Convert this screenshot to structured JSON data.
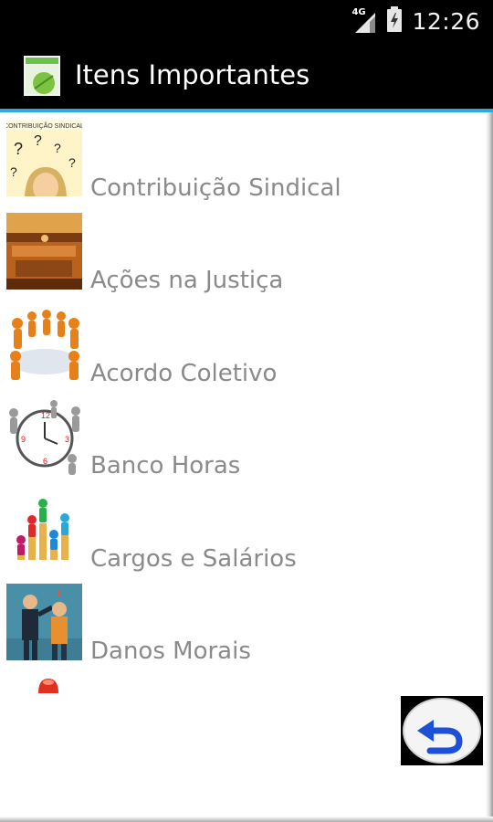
{
  "status_bar": {
    "network": "4G",
    "time": "12:26"
  },
  "action_bar": {
    "title": "Itens Importantes"
  },
  "list": {
    "items": [
      {
        "label": "Contribuição Sindical",
        "thumb": "question-woman-image",
        "thumb_caption": "CONTRIBUIÇÃO SINDICAL"
      },
      {
        "label": "Ações na Justiça",
        "thumb": "courtroom-image"
      },
      {
        "label": "Acordo Coletivo",
        "thumb": "meeting-table-image"
      },
      {
        "label": "Banco Horas",
        "thumb": "clock-people-image"
      },
      {
        "label": "Cargos e Salários",
        "thumb": "colored-people-bars-image"
      },
      {
        "label": "Danos Morais",
        "thumb": "businessmen-image"
      }
    ]
  },
  "colors": {
    "action_bar_bg": "#000000",
    "action_bar_divider": "#2fa7df",
    "label_text": "#8a8a8a",
    "back_arrow": "#1e4fd8"
  },
  "icons": {
    "app": "android-app-icon",
    "back": "back-arrow-icon"
  }
}
